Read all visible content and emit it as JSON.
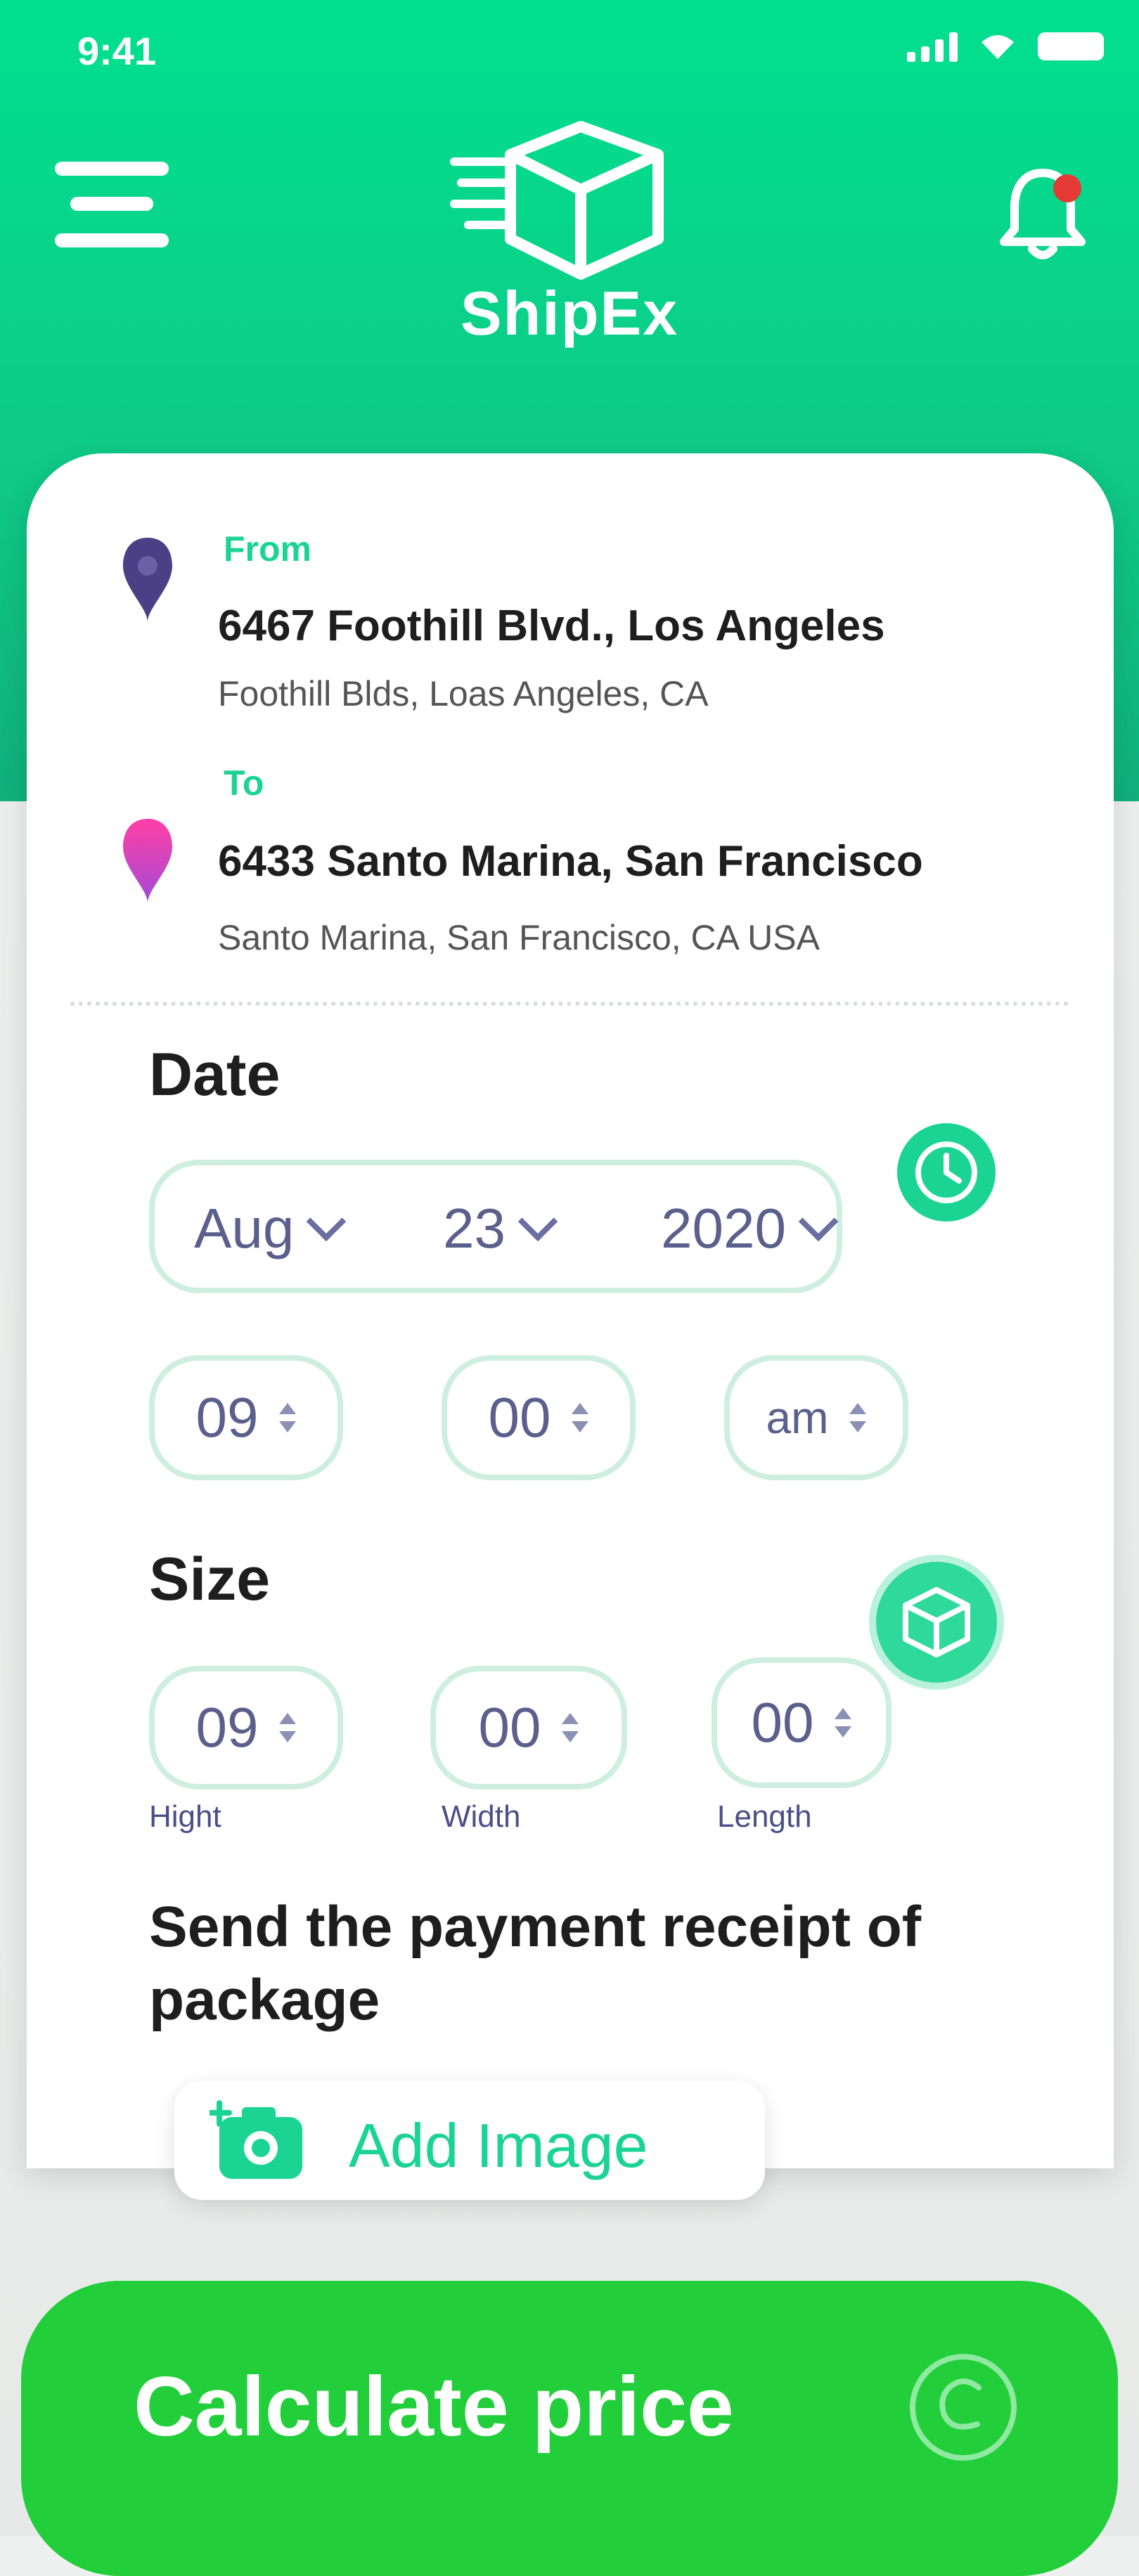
{
  "status_bar": {
    "time": "9:41"
  },
  "header": {
    "brand": "ShipEx"
  },
  "route": {
    "from": {
      "label": "From",
      "address": "6467 Foothill Blvd., Los Angeles",
      "sub": "Foothill Blds, Loas Angeles, CA"
    },
    "to": {
      "label": "To",
      "address": "6433 Santo Marina, San Francisco",
      "sub": "Santo Marina, San Francisco, CA USA"
    }
  },
  "date": {
    "title": "Date",
    "month": "Aug",
    "day": "23",
    "year": "2020",
    "hour": "09",
    "minute": "00",
    "period": "am"
  },
  "size": {
    "title": "Size",
    "height": {
      "value": "09",
      "label": "Hight"
    },
    "width": {
      "value": "00",
      "label": "Width"
    },
    "length": {
      "value": "00",
      "label": "Length"
    }
  },
  "receipt": {
    "text": "Send the payment receipt of package",
    "button_label": "Add Image"
  },
  "cta": {
    "label": "Calculate price"
  },
  "colors": {
    "primary": "#1bd494",
    "cta": "#22cf3a",
    "text_dark": "#1e1e1e",
    "input_text": "#5a5f8c"
  }
}
